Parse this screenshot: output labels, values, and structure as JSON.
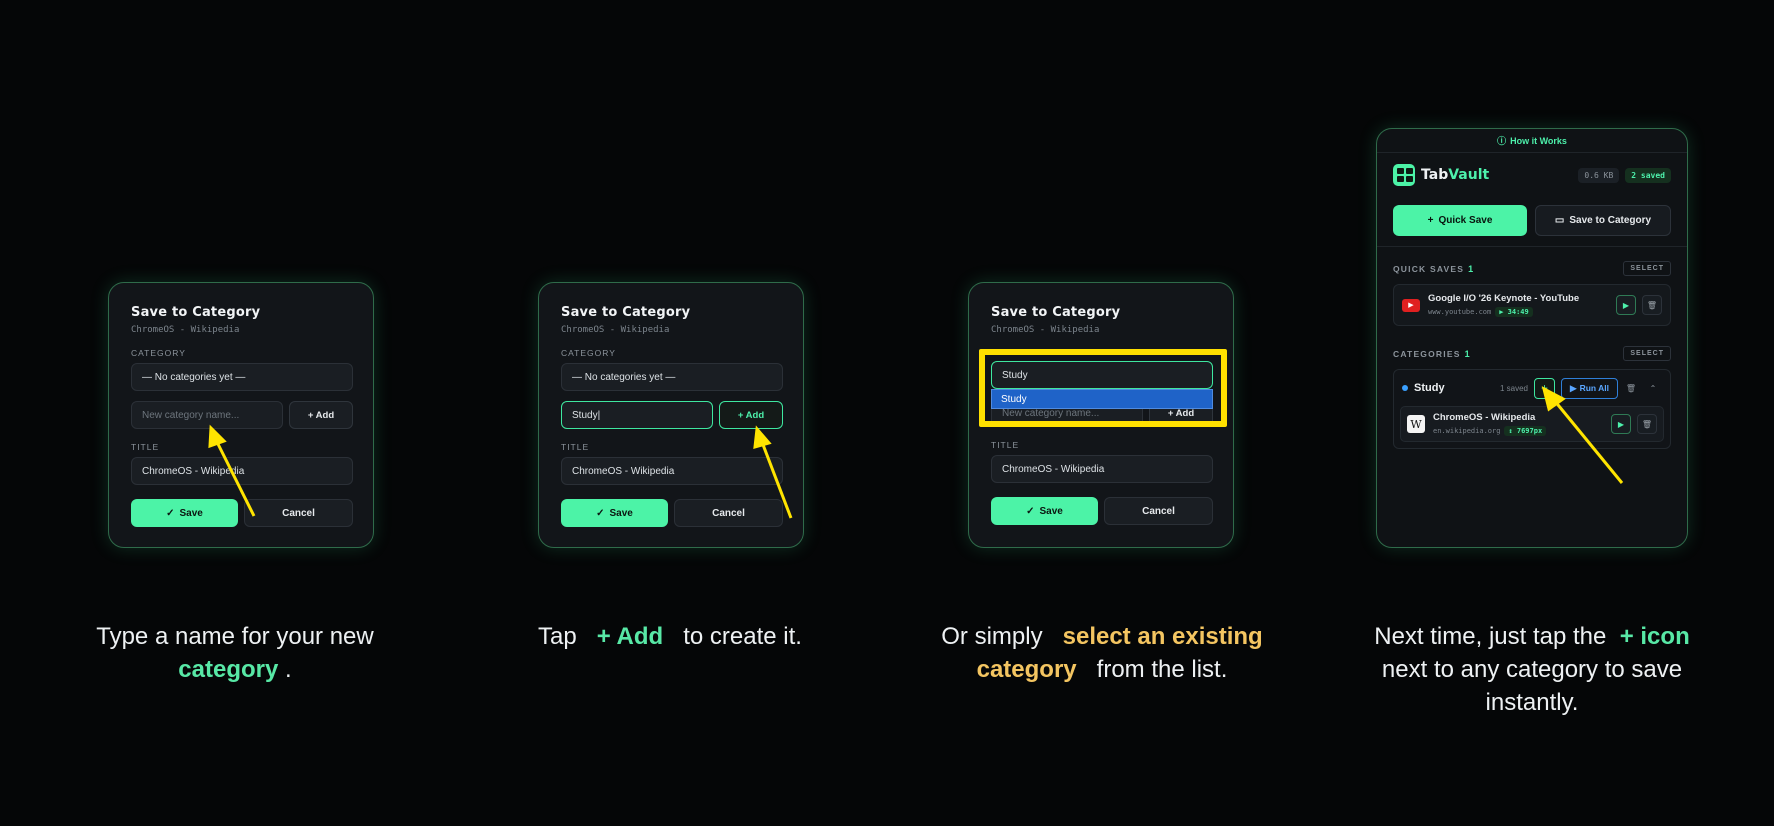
{
  "dialog": {
    "title": "Save to Category",
    "subtitle": "ChromeOS - Wikipedia",
    "category_label": "CATEGORY",
    "no_categories": "— No categories yet —",
    "new_category_placeholder": "New category name...",
    "add_label": "+ Add",
    "title_label": "TITLE",
    "title_value": "ChromeOS - Wikipedia",
    "save_label": "Save",
    "cancel_label": "Cancel"
  },
  "step2": {
    "typed_value": "Study|"
  },
  "step3": {
    "selected_category": "Study",
    "dropdown_option": "Study"
  },
  "panel": {
    "how_it_works": "How it Works",
    "brand_a": "Tab",
    "brand_b": "Vault",
    "storage": "0.6 KB",
    "saved_badge": "2 saved",
    "quick_save": "Quick Save",
    "save_to_category": "Save to Category",
    "quick_saves_label": "QUICK SAVES",
    "quick_saves_count": "1",
    "select_label": "SELECT",
    "quick_item": {
      "title": "Google I/O '26 Keynote - YouTube",
      "url": "www.youtube.com",
      "time": "▶ 34:49"
    },
    "categories_label": "CATEGORIES",
    "categories_count": "1",
    "category": {
      "name": "Study",
      "count": "1 saved",
      "run_all": "Run All"
    },
    "category_item": {
      "title": "ChromeOS - Wikipedia",
      "url": "en.wikipedia.org",
      "scroll": "↕ 7697px"
    }
  },
  "captions": {
    "c1_a": "Type a name for your new",
    "c1_b": "category",
    "c1_c": ".",
    "c2_a": "Tap",
    "c2_b": "+ Add",
    "c2_c": "to create it.",
    "c3_a": "Or simply",
    "c3_b": "select an existing",
    "c3_c": "category",
    "c3_d": "from the list.",
    "c4_a": "Next time, just tap the",
    "c4_b": "+ icon",
    "c4_c": "next to any category to save",
    "c4_d": "instantly."
  },
  "colors": {
    "accent": "#4cf3a7",
    "highlight": "#ffe000",
    "caption_yellow": "#f4c561"
  }
}
